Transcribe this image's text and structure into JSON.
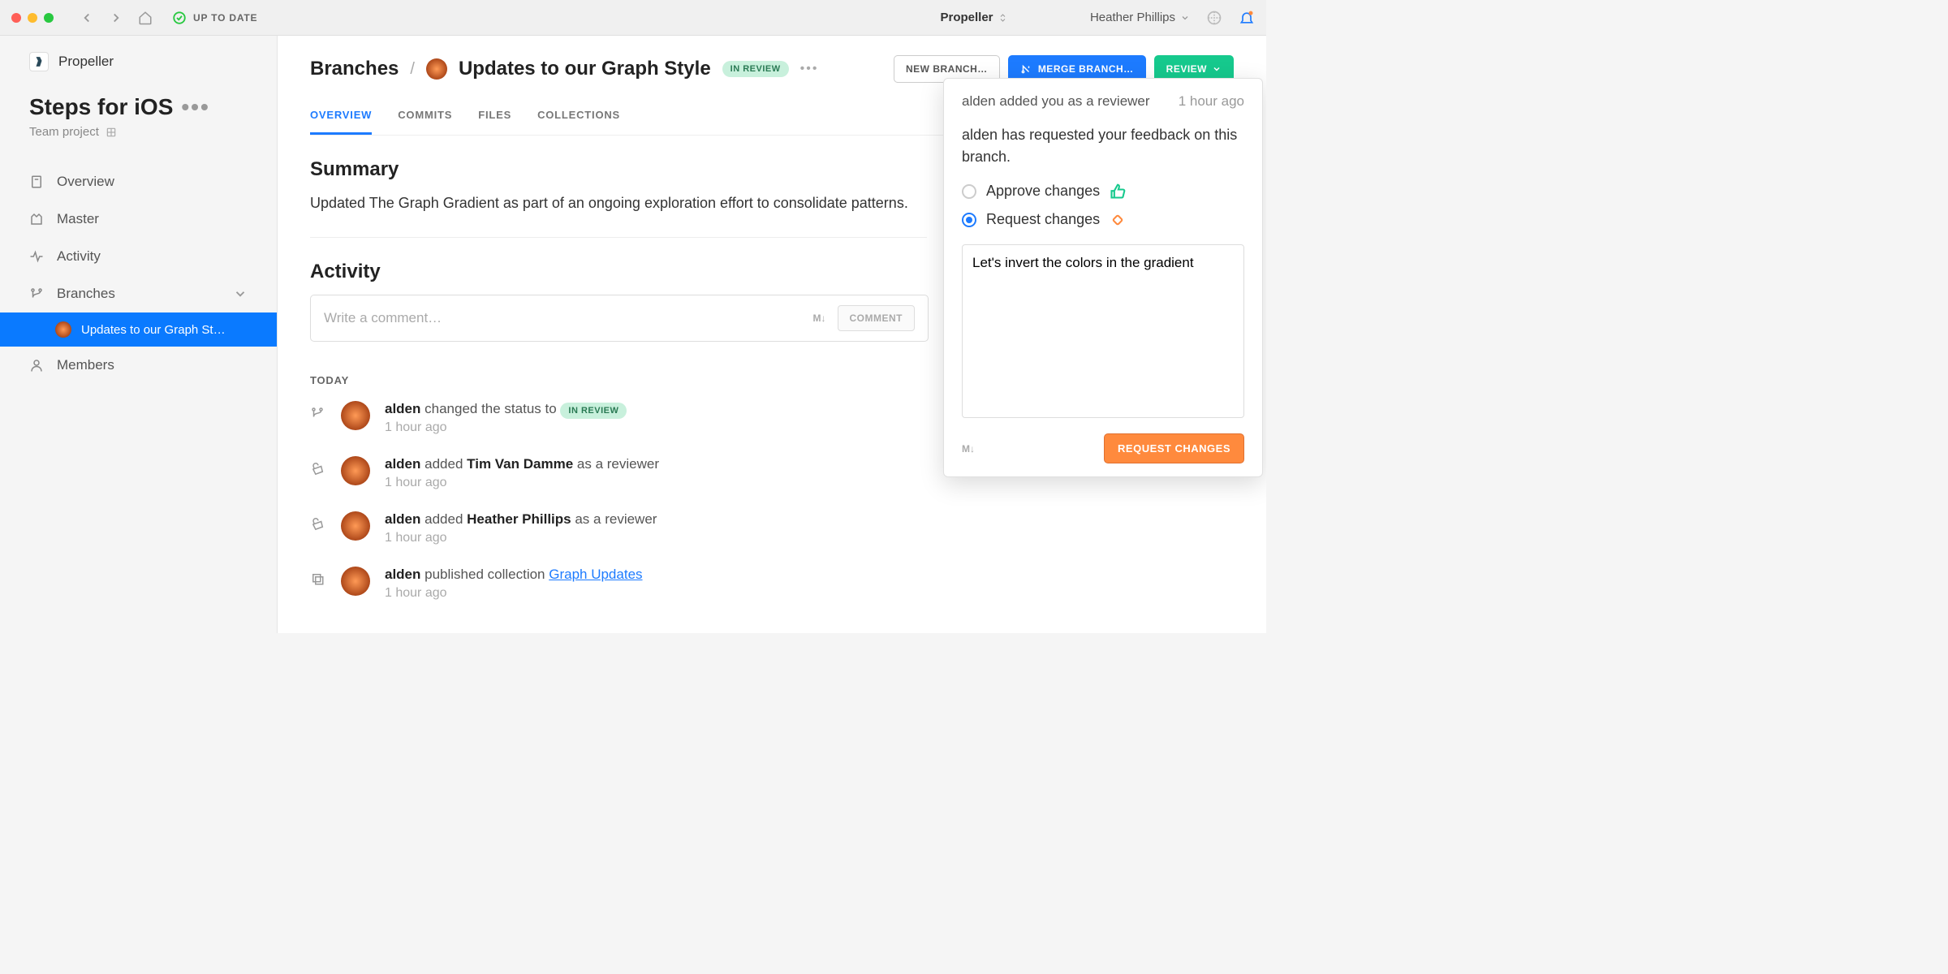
{
  "titlebar": {
    "sync_status": "UP TO DATE",
    "title": "Propeller",
    "user": "Heather Phillips"
  },
  "sidebar": {
    "org": "Propeller",
    "project_title": "Steps for iOS",
    "project_sub": "Team project",
    "nav": {
      "overview": "Overview",
      "master": "Master",
      "activity": "Activity",
      "branches": "Branches",
      "members": "Members"
    },
    "branch_item": "Updates to our Graph St…"
  },
  "breadcrumb": {
    "root": "Branches",
    "current": "Updates to our Graph Style",
    "badge": "IN REVIEW"
  },
  "actions": {
    "new_branch": "NEW BRANCH…",
    "merge": "MERGE BRANCH…",
    "review": "REVIEW"
  },
  "tabs": {
    "overview": "OVERVIEW",
    "commits": "COMMITS",
    "files": "FILES",
    "collections": "COLLECTIONS"
  },
  "summary": {
    "heading": "Summary",
    "text": "Updated The Graph Gradient as part of an ongoing exploration effort to consolidate patterns."
  },
  "activity": {
    "heading": "Activity",
    "placeholder": "Write a comment…",
    "comment_btn": "COMMENT",
    "today": "TODAY",
    "items": [
      {
        "user": "alden",
        "text": " changed the status to ",
        "badge": "IN REVIEW",
        "time": "1 hour ago"
      },
      {
        "user": "alden",
        "text1": " added ",
        "name": "Tim Van Damme",
        "text2": " as a reviewer",
        "time": "1 hour ago"
      },
      {
        "user": "alden",
        "text1": " added ",
        "name": "Heather Phillips",
        "text2": " as a reviewer",
        "time": "1 hour ago"
      },
      {
        "user": "alden",
        "text": " published collection ",
        "link": "Graph Updates",
        "time": "1 hour ago"
      }
    ]
  },
  "popover": {
    "head": "alden added you as a reviewer",
    "time": "1 hour ago",
    "text": "alden has requested your feedback on this branch.",
    "approve": "Approve changes",
    "request": "Request changes",
    "comment": "Let's invert the colors in the gradient",
    "submit": "REQUEST CHANGES"
  }
}
